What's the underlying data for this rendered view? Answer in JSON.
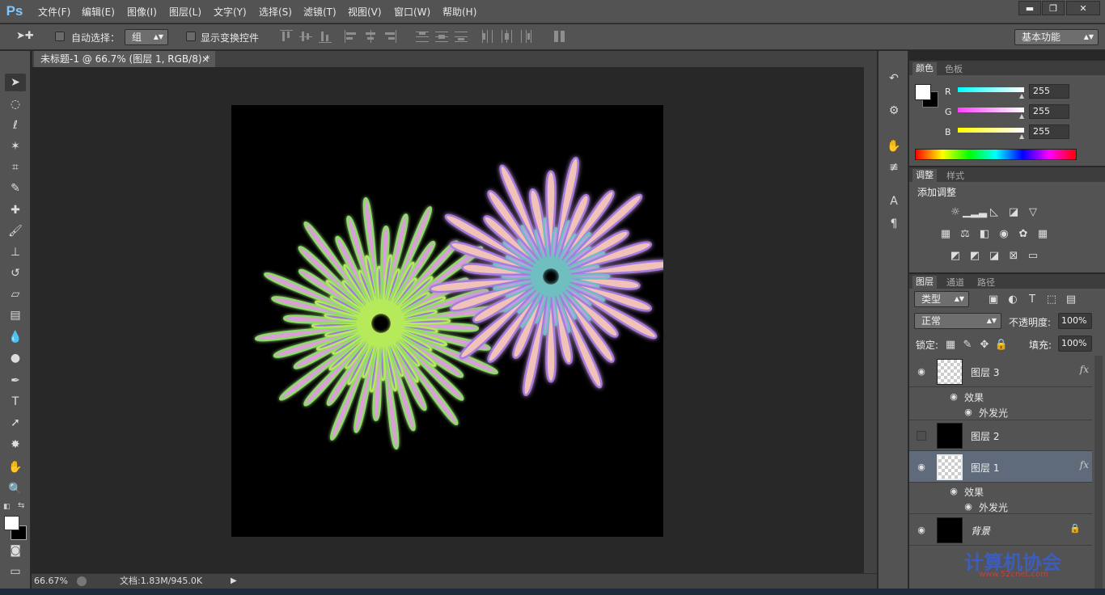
{
  "app": {
    "logo": "Ps"
  },
  "menu": [
    "文件(F)",
    "编辑(E)",
    "图像(I)",
    "图层(L)",
    "文字(Y)",
    "选择(S)",
    "滤镜(T)",
    "视图(V)",
    "窗口(W)",
    "帮助(H)"
  ],
  "window_controls": {
    "minimize": "▬",
    "restore": "❐",
    "close": "✕"
  },
  "options": {
    "auto_select_label": "自动选择：",
    "auto_select_value": "组",
    "show_transform_label": "显示变换控件",
    "workspace_value": "基本功能"
  },
  "document": {
    "tab_title": "未标题-1 @ 66.7% (图层 1, RGB/8) *",
    "close": "×"
  },
  "status": {
    "zoom": "66.67%",
    "doc_size": "文档:1.83M/945.0K"
  },
  "color_panel": {
    "tabs": [
      "颜色",
      "色板"
    ],
    "channels": [
      {
        "label": "R",
        "value": "255",
        "color": "#00ffff"
      },
      {
        "label": "G",
        "value": "255",
        "color": "#ff40ff"
      },
      {
        "label": "B",
        "value": "255",
        "color": "#ffff00"
      }
    ]
  },
  "adjust_panel": {
    "tabs": [
      "调整",
      "样式"
    ],
    "title": "添加调整",
    "icons_row1": [
      "brightness-icon",
      "levels-icon",
      "curves-icon",
      "exposure-icon",
      "vibrance-icon"
    ],
    "icons_row2": [
      "hue-saturation-icon",
      "color-balance-icon",
      "black-white-icon",
      "photo-filter-icon",
      "channel-mixer-icon",
      "color-lookup-icon"
    ],
    "icons_row3": [
      "invert-icon",
      "posterize-icon",
      "threshold-icon",
      "selective-color-icon",
      "gradient-map-icon"
    ]
  },
  "layers_panel": {
    "tabs": [
      "图层",
      "通道",
      "路径"
    ],
    "filter_value": "类型",
    "blend_mode": "正常",
    "opacity_label": "不透明度:",
    "opacity_value": "100%",
    "lock_label": "锁定:",
    "fill_label": "填充:",
    "fill_value": "100%",
    "effects_label": "效果",
    "outer_glow_label": "外发光",
    "fx": "fx",
    "layers": [
      {
        "name": "图层 3",
        "visible": true,
        "has_fx": true,
        "thumb": "transparent"
      },
      {
        "name": "图层 2",
        "visible": false,
        "has_fx": false,
        "thumb": "black"
      },
      {
        "name": "图层 1",
        "visible": true,
        "has_fx": true,
        "thumb": "transparent",
        "selected": true
      },
      {
        "name": "背景",
        "visible": true,
        "has_fx": false,
        "thumb": "black",
        "locked": true
      }
    ]
  },
  "watermark": {
    "text": "计算机协会",
    "sub": "www.52cnet.com"
  }
}
